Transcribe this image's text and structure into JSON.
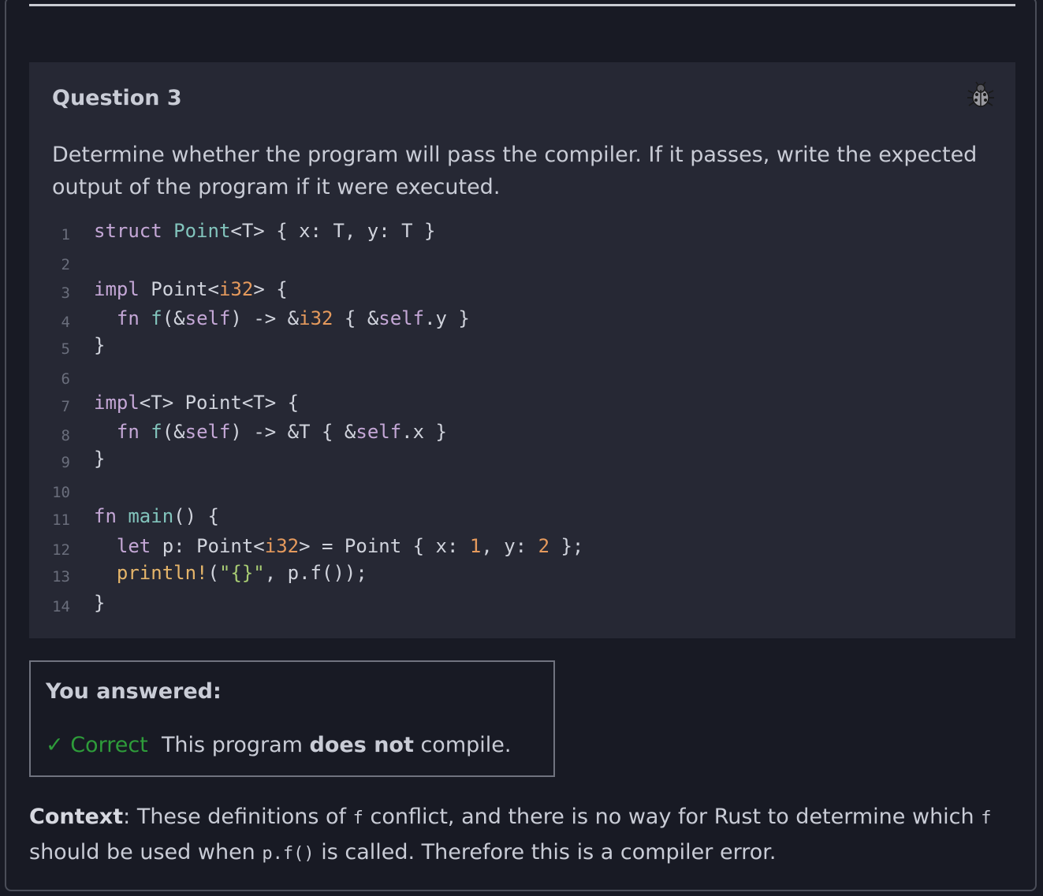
{
  "question": {
    "title": "Question 3",
    "prompt": "Determine whether the program will pass the compiler. If it passes, write the expected output of the program if it were executed.",
    "bug_icon": "bug-icon"
  },
  "code": {
    "line_numbers": [
      "1",
      "2",
      "3",
      "4",
      "5",
      "6",
      "7",
      "8",
      "9",
      "10",
      "11",
      "12",
      "13",
      "14"
    ],
    "lines": [
      "struct Point<T> { x: T, y: T }",
      "",
      "impl Point<i32> {",
      "  fn f(&self) -> &i32 { &self.y }",
      "}",
      "",
      "impl<T> Point<T> {",
      "  fn f(&self) -> &T { &self.x }",
      "}",
      "",
      "fn main() {",
      "  let p: Point<i32> = Point { x: 1, y: 2 };",
      "  println!(\"{}\", p.f());",
      "}"
    ]
  },
  "answer": {
    "title": "You answered:",
    "status": "✓ Correct",
    "text_before": "This program ",
    "text_bold": "does not",
    "text_after": " compile."
  },
  "context": {
    "label": "Context",
    "part1": ": These definitions of ",
    "code1": "f",
    "part2": " conflict, and there is no way for Rust to determine which ",
    "code2": "f",
    "part3": " should be used when ",
    "code3": "p.f()",
    "part4": " is called. Therefore this is a compiler error."
  }
}
